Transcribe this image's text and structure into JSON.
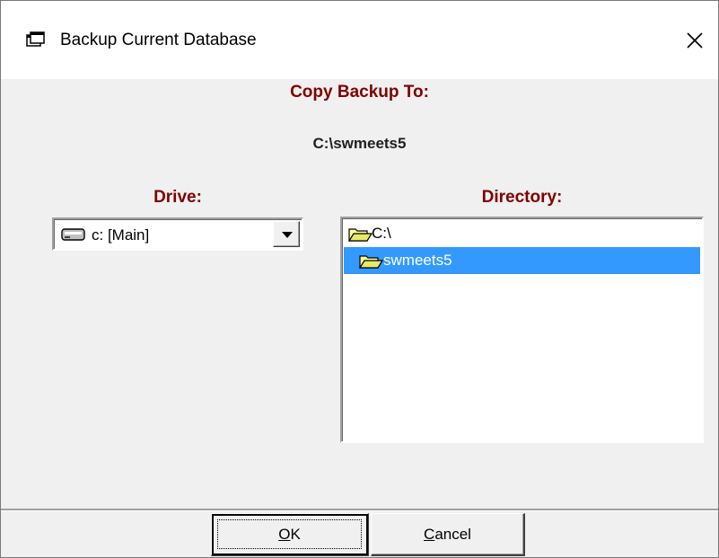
{
  "window": {
    "title": "Backup Current Database",
    "close_glyph": "✕",
    "title_icon": "window-app-icon"
  },
  "dialog": {
    "copy_backup_label": "Copy Backup To:",
    "backup_path": "C:\\swmeets5",
    "drive_label": "Drive:",
    "directory_label": "Directory:"
  },
  "drive_select": {
    "value": "c: [Main]",
    "icon": "drive-icon"
  },
  "directory_list": {
    "items": [
      {
        "label": "C:\\",
        "icon": "open-folder-icon",
        "selected": false
      },
      {
        "label": "swmeets5",
        "icon": "open-folder-icon",
        "selected": true
      }
    ]
  },
  "buttons": {
    "ok_label": "OK",
    "cancel_label": "Cancel"
  },
  "colors": {
    "accent_label": "#800000",
    "selection": "#3399ff",
    "face": "#f0f0f0"
  }
}
